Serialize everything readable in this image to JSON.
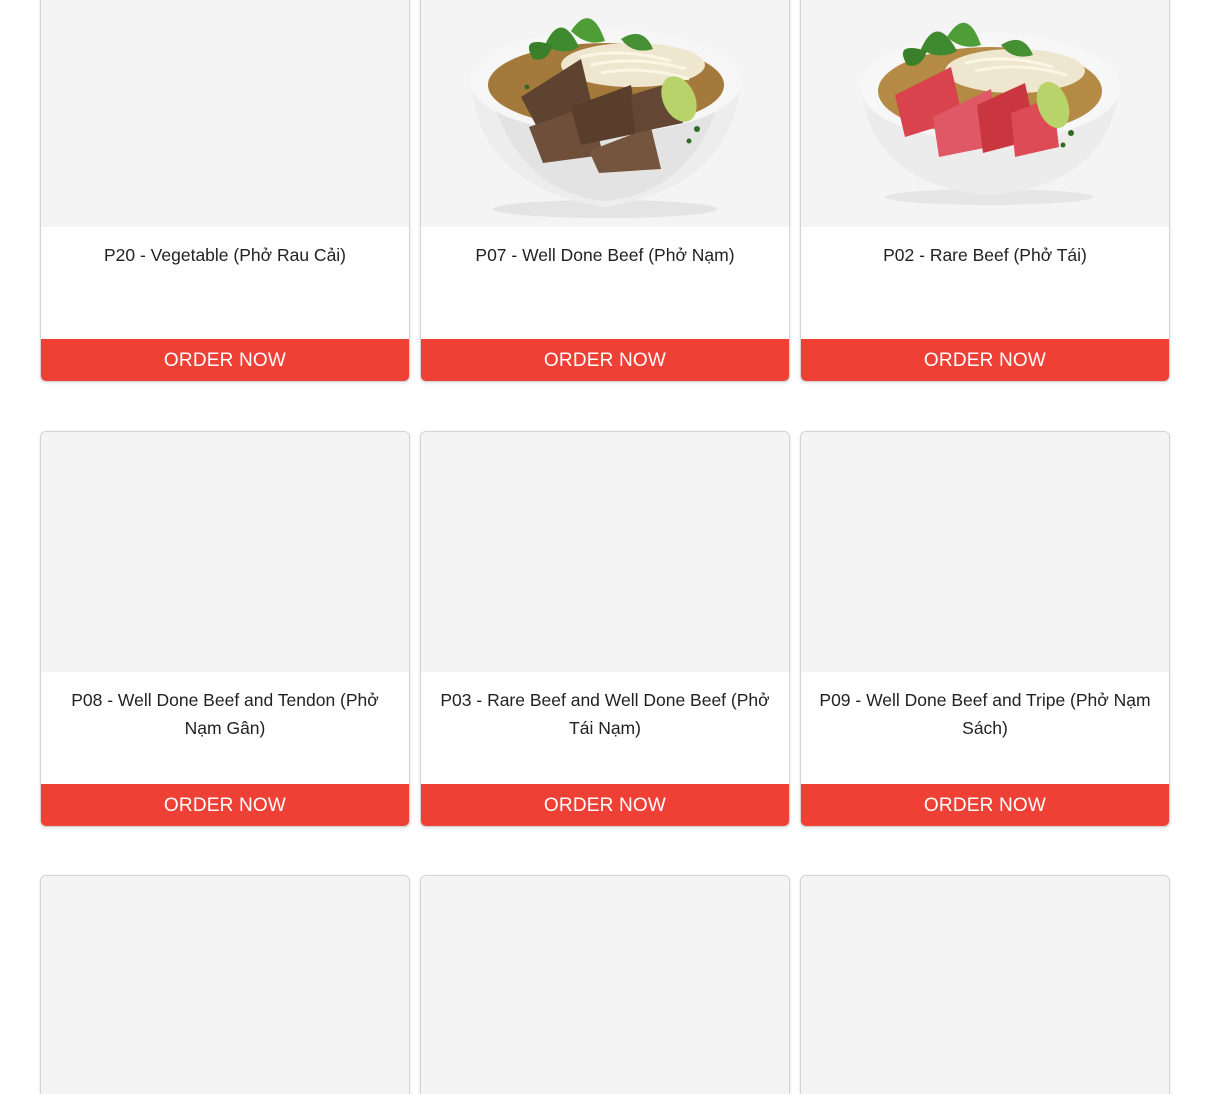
{
  "order_label": "ORDER NOW",
  "menu_items": [
    {
      "name": "P20 - Vegetable (Phở Rau Cải)",
      "image": "none"
    },
    {
      "name": "P07 - Well Done Beef (Phở Nạm)",
      "image": "pho-bowl-well-done-beef"
    },
    {
      "name": "P02 - Rare Beef (Phở Tái)",
      "image": "pho-bowl-rare-beef"
    },
    {
      "name": "P08 - Well Done Beef and Tendon (Phở Nạm Gân)",
      "image": "none"
    },
    {
      "name": "P03 - Rare Beef and Well Done Beef (Phở Tái Nạm)",
      "image": "none"
    },
    {
      "name": "P09 - Well Done Beef and Tripe (Phở Nạm Sách)",
      "image": "none"
    }
  ],
  "colors": {
    "order_button": "#ee4035",
    "image_placeholder": "#f4f4f4",
    "card_border": "#d4d4d4"
  }
}
